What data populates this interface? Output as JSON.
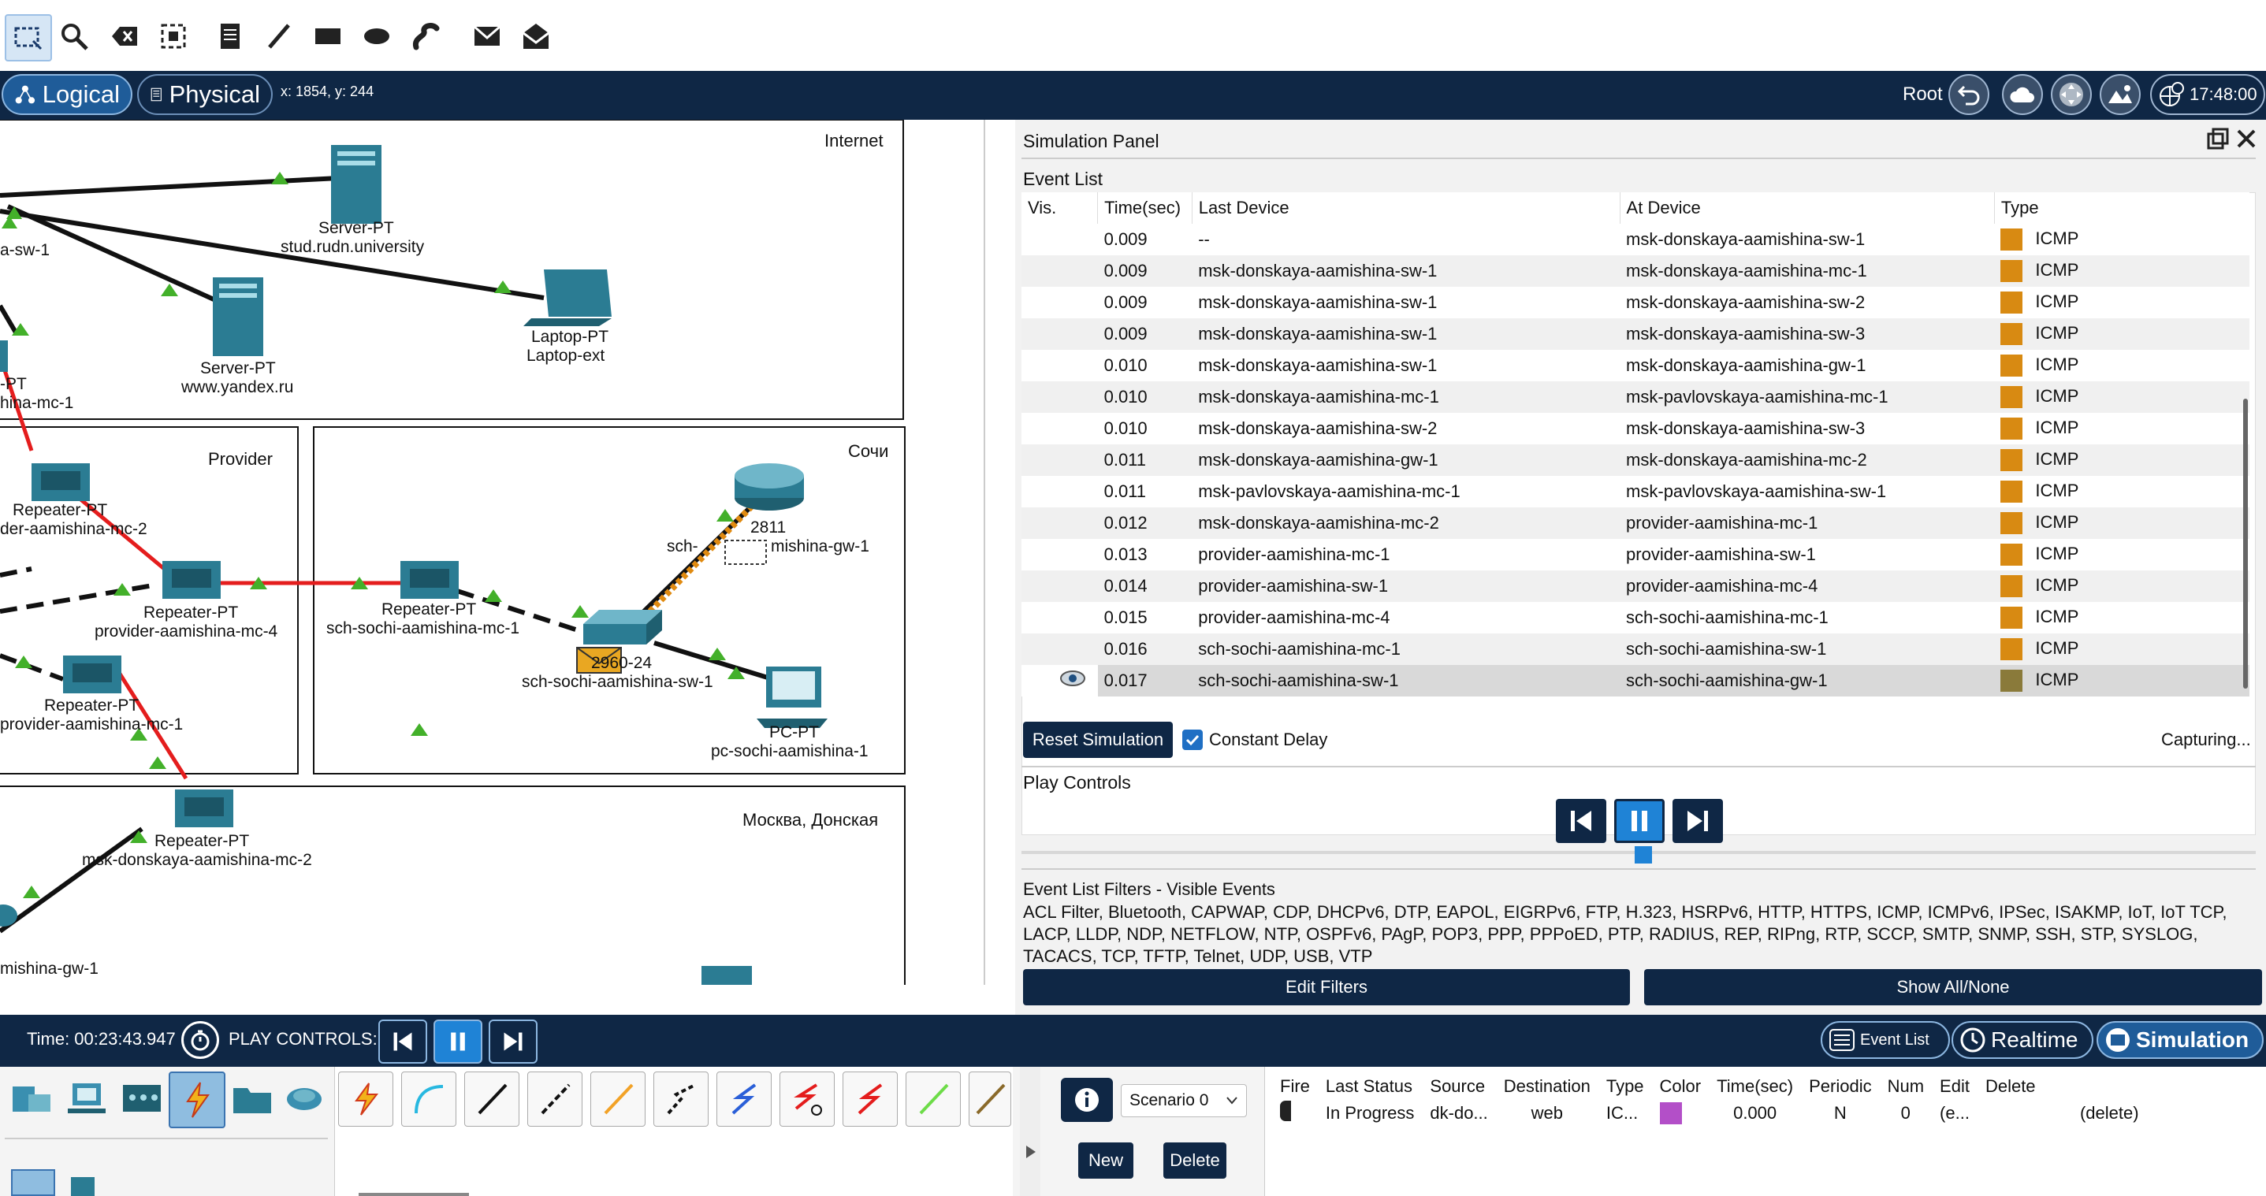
{
  "toolbar": {
    "tools": [
      "select-icon",
      "zoom-icon",
      "delete-icon",
      "resize-icon",
      "note-icon",
      "line-icon",
      "rectangle-icon",
      "ellipse-icon",
      "freeform-icon",
      "pdu-simple-icon",
      "pdu-complex-icon"
    ]
  },
  "modebar": {
    "logical_label": "Logical",
    "physical_label": "Physical",
    "coords": "x: 1854, y: 244",
    "root_label": "Root",
    "clock": "17:48:00"
  },
  "canvas": {
    "zones": {
      "internet": "Internet",
      "provider": "Provider",
      "sochi": "Сочи",
      "moscow": "Москва, Донская"
    },
    "devices": {
      "server1_type": "Server-PT",
      "server1_name": "stud.rudn.university",
      "server2_type": "Server-PT",
      "server2_name": "www.yandex.ru",
      "laptop_type": "Laptop-PT",
      "laptop_name": "Laptop-ext",
      "sw_left": "a-sw-1",
      "pt_left": "-PT",
      "mc_left": "hina-mc-1",
      "rep1_type": "Repeater-PT",
      "rep1_name": "der-aamishina-mc-2",
      "rep2_type": "Repeater-PT",
      "rep2_name": "provider-aamishina-mc-4",
      "rep3_type": "Repeater-PT",
      "rep3_name": "provider-aamishina-mc-1",
      "rep4_type": "Repeater-PT",
      "rep4_name": "sch-sochi-aamishina-mc-1",
      "router_model": "2811",
      "router_name_a": "sch-",
      "router_name_b": "mishina-gw-1",
      "switch_model": "2960-24",
      "switch_name": "sch-sochi-aamishina-sw-1",
      "pc_type": "PC-PT",
      "pc_name": "pc-sochi-aamishina-1",
      "rep5_type": "Repeater-PT",
      "rep5_name": "msk-donskaya-aamishina-mc-2",
      "gw_left": "mishina-gw-1"
    }
  },
  "sim_panel": {
    "title": "Simulation Panel",
    "event_list_label": "Event List",
    "columns": [
      "Vis.",
      "Time(sec)",
      "Last Device",
      "At Device",
      "Type"
    ],
    "events": [
      {
        "time": "0.009",
        "last": "--",
        "at": "msk-donskaya-aamishina-sw-1",
        "type": "ICMP"
      },
      {
        "time": "0.009",
        "last": "msk-donskaya-aamishina-sw-1",
        "at": "msk-donskaya-aamishina-mc-1",
        "type": "ICMP"
      },
      {
        "time": "0.009",
        "last": "msk-donskaya-aamishina-sw-1",
        "at": "msk-donskaya-aamishina-sw-2",
        "type": "ICMP"
      },
      {
        "time": "0.009",
        "last": "msk-donskaya-aamishina-sw-1",
        "at": "msk-donskaya-aamishina-sw-3",
        "type": "ICMP"
      },
      {
        "time": "0.010",
        "last": "msk-donskaya-aamishina-sw-1",
        "at": "msk-donskaya-aamishina-gw-1",
        "type": "ICMP"
      },
      {
        "time": "0.010",
        "last": "msk-donskaya-aamishina-mc-1",
        "at": "msk-pavlovskaya-aamishina-mc-1",
        "type": "ICMP"
      },
      {
        "time": "0.010",
        "last": "msk-donskaya-aamishina-sw-2",
        "at": "msk-donskaya-aamishina-sw-3",
        "type": "ICMP"
      },
      {
        "time": "0.011",
        "last": "msk-donskaya-aamishina-gw-1",
        "at": "msk-donskaya-aamishina-mc-2",
        "type": "ICMP"
      },
      {
        "time": "0.011",
        "last": "msk-pavlovskaya-aamishina-mc-1",
        "at": "msk-pavlovskaya-aamishina-sw-1",
        "type": "ICMP"
      },
      {
        "time": "0.012",
        "last": "msk-donskaya-aamishina-mc-2",
        "at": "provider-aamishina-mc-1",
        "type": "ICMP"
      },
      {
        "time": "0.013",
        "last": "provider-aamishina-mc-1",
        "at": "provider-aamishina-sw-1",
        "type": "ICMP"
      },
      {
        "time": "0.014",
        "last": "provider-aamishina-sw-1",
        "at": "provider-aamishina-mc-4",
        "type": "ICMP"
      },
      {
        "time": "0.015",
        "last": "provider-aamishina-mc-4",
        "at": "sch-sochi-aamishina-mc-1",
        "type": "ICMP"
      },
      {
        "time": "0.016",
        "last": "sch-sochi-aamishina-mc-1",
        "at": "sch-sochi-aamishina-sw-1",
        "type": "ICMP"
      },
      {
        "time": "0.017",
        "last": "sch-sochi-aamishina-sw-1",
        "at": "sch-sochi-aamishina-gw-1",
        "type": "ICMP"
      }
    ],
    "icmp_color": "#d88a12",
    "current_color": "#8a7a3a",
    "reset_label": "Reset Simulation",
    "constant_delay_label": "Constant Delay",
    "capturing_label": "Capturing...",
    "play_controls_label": "Play Controls",
    "filters_title": "Event List Filters - Visible Events",
    "filters_text": "ACL Filter, Bluetooth, CAPWAP, CDP, DHCPv6, DTP, EAPOL, EIGRPv6, FTP, H.323, HSRPv6, HTTP, HTTPS, ICMP, ICMPv6, IPSec, ISAKMP, IoT, IoT TCP, LACP, LLDP, NDP, NETFLOW, NTP, OSPFv6, PAgP, POP3, PPP, PPPoED, PTP, RADIUS, REP, RIPng, RTP, SCCP, SMTP, SNMP, SSH, STP, SYSLOG, TACACS, TCP, TFTP, Telnet, UDP, USB, VTP",
    "edit_filters_label": "Edit Filters",
    "show_all_label": "Show All/None"
  },
  "bottombar": {
    "time": "Time: 00:23:43.947",
    "play_controls": "PLAY CONTROLS:",
    "event_list_btn": "Event List",
    "realtime_btn": "Realtime",
    "simulation_btn": "Simulation"
  },
  "scenario": {
    "selected": "Scenario 0",
    "new_label": "New",
    "delete_label": "Delete"
  },
  "pdu_list": {
    "columns": [
      "Fire",
      "Last Status",
      "Source",
      "Destination",
      "Type",
      "Color",
      "Time(sec)",
      "Periodic",
      "Num",
      "Edit",
      "Delete"
    ],
    "row": {
      "status": "In Progress",
      "source": "dk-do...",
      "destination": "web",
      "type": "IC...",
      "time": "0.000",
      "periodic": "N",
      "num": "0",
      "edit": "(e...",
      "delete": "(delete)"
    },
    "row_color": "#b34fc8"
  }
}
